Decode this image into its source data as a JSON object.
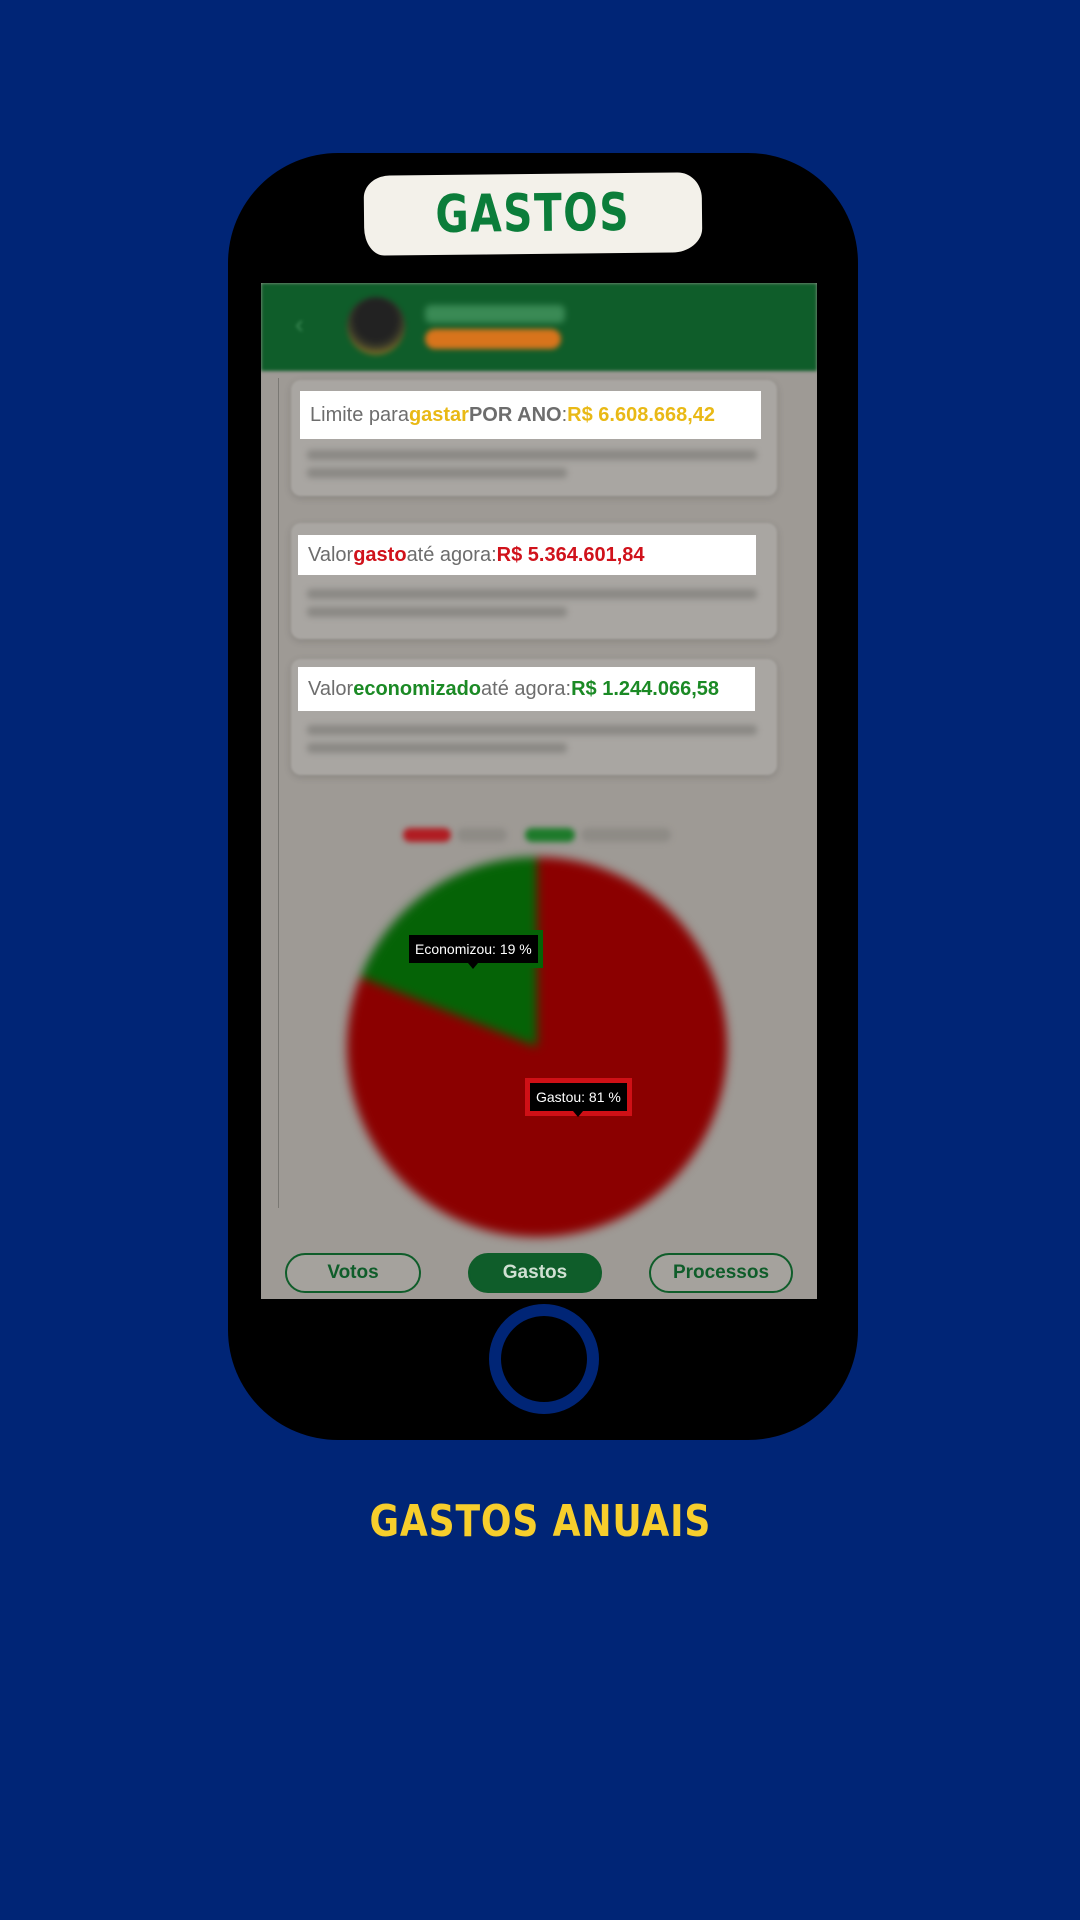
{
  "banner": {
    "title": "GASTOS"
  },
  "cards": [
    {
      "prefix": "Limite para ",
      "keyword": "gastar",
      "extra": " POR ANO",
      "sep": ": ",
      "value": "R$ 6.608.668,42",
      "accent": "#e9b916"
    },
    {
      "prefix": "Valor ",
      "keyword": "gasto",
      "suffix": " até agora: ",
      "value": "R$ 5.364.601,84",
      "accent": "#d0121b"
    },
    {
      "prefix": "Valor ",
      "keyword": "economizado",
      "suffix": " até agora: ",
      "value": "R$ 1.244.066,58",
      "accent": "#1b8a25"
    }
  ],
  "chart_data": {
    "type": "pie",
    "slices": [
      {
        "label": "Gastou",
        "value": 81,
        "color": "#8b0000"
      },
      {
        "label": "Economizou",
        "value": 19,
        "color": "#056306"
      }
    ],
    "tooltips": [
      "Economizou: 19 %",
      "Gastou: 81 %"
    ]
  },
  "tabs": [
    {
      "label": "Votos",
      "active": false
    },
    {
      "label": "Gastos",
      "active": true
    },
    {
      "label": "Processos",
      "active": false
    }
  ],
  "icons": {
    "back": "chevron-left-icon",
    "home": "home-button-ring"
  },
  "colors": {
    "background": "#002576",
    "brand_green": "#0f5d2a",
    "caption": "#f7ce2c"
  },
  "caption": "GASTOS ANUAIS"
}
